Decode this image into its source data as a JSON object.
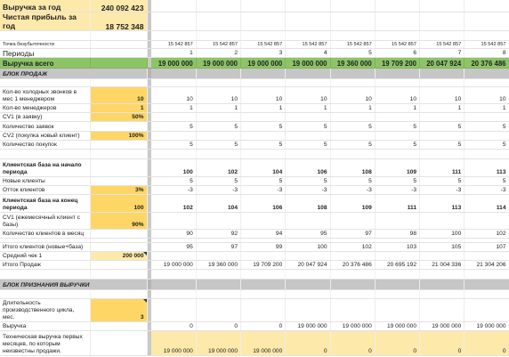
{
  "kpi": {
    "revenue_label": "Выручка за год",
    "revenue_value": "240 092 423",
    "profit_label": "Чистая прибыль за год",
    "profit_value": "18 752 348"
  },
  "breakeven": {
    "label": "Точка безубыточности",
    "values": [
      "15 542 857",
      "15 542 857",
      "15 542 857",
      "15 542 857",
      "15 542 857",
      "15 542 857",
      "15 542 857",
      "15 542 857"
    ]
  },
  "periods": {
    "label": "Периоды",
    "values": [
      "1",
      "2",
      "3",
      "4",
      "5",
      "6",
      "7",
      "8"
    ]
  },
  "revenue_total": {
    "label": "Выручка всего",
    "values": [
      "19 000 000",
      "19 000 000",
      "19 000 000",
      "19 000 000",
      "19 360 000",
      "19 709 200",
      "20 047 924",
      "20 376 486"
    ]
  },
  "sales_block": {
    "title": "БЛОК ПРОДАЖ",
    "rows": [
      {
        "label": "Кол-во холодных звонков в мес 1 менеджером",
        "input": "10",
        "values": [
          "10",
          "10",
          "10",
          "10",
          "10",
          "10",
          "10",
          "10"
        ]
      },
      {
        "label": "Кол-во менеджеров",
        "input": "1",
        "values": [
          "1",
          "1",
          "1",
          "1",
          "1",
          "1",
          "1",
          "1"
        ]
      },
      {
        "label": "CV1 (в заявку)",
        "input": "50%",
        "values": [
          "",
          "",
          "",
          "",
          "",
          "",
          "",
          ""
        ]
      },
      {
        "label": "Количество заявок",
        "input": "",
        "values": [
          "5",
          "5",
          "5",
          "5",
          "5",
          "5",
          "5",
          "5"
        ]
      },
      {
        "label": "CV2 (покупка новый клиент)",
        "input": "100%",
        "values": [
          "",
          "",
          "",
          "",
          "",
          "",
          "",
          ""
        ]
      },
      {
        "label": "Количество покупок",
        "input": "",
        "values": [
          "5",
          "5",
          "5",
          "5",
          "5",
          "5",
          "5",
          "5"
        ]
      },
      {
        "label": "Клиентская база на начало периода",
        "input": "",
        "values": [
          "100",
          "102",
          "104",
          "106",
          "108",
          "109",
          "111",
          "113"
        ]
      },
      {
        "label": "Новые клиенты",
        "input": "",
        "values": [
          "5",
          "5",
          "5",
          "5",
          "5",
          "5",
          "5",
          "5"
        ]
      },
      {
        "label": "Отток клиентов",
        "input": "3%",
        "values": [
          "-3",
          "-3",
          "-3",
          "-3",
          "-3",
          "-3",
          "-3",
          "-3"
        ]
      },
      {
        "label": "Клиентская база на конец периода",
        "input": "100",
        "values": [
          "102",
          "104",
          "106",
          "108",
          "109",
          "111",
          "113",
          "114"
        ]
      },
      {
        "label": "CV1 (ежемесячный клиент с базы)",
        "input": "90%",
        "values": [
          "",
          "",
          "",
          "",
          "",
          "",
          "",
          ""
        ]
      },
      {
        "label": "Количество клиентов в месяц",
        "input": "",
        "values": [
          "90",
          "92",
          "94",
          "95",
          "97",
          "98",
          "100",
          "102"
        ]
      },
      {
        "label": "Итого клиентов (новые+база)",
        "input": "",
        "values": [
          "95",
          "97",
          "99",
          "100",
          "102",
          "103",
          "105",
          "107"
        ]
      },
      {
        "label": "Средний чек 1",
        "input": "200 000",
        "values": [
          "",
          "",
          "",
          "",
          "",
          "",
          "",
          ""
        ]
      },
      {
        "label": "Итого Продаж",
        "input": "",
        "values": [
          "19 000 000",
          "19 360 000",
          "19 709 200",
          "20 047 924",
          "20 376 486",
          "20 695 192",
          "21 004 336",
          "21 304 206"
        ]
      }
    ]
  },
  "recognition_block": {
    "title": "БЛОК ПРИЗНАНИЯ ВЫРУЧКИ",
    "rows": [
      {
        "label": "Длительность производственного цикла, мес.",
        "input": "3",
        "values": [
          "",
          "",
          "",
          "",
          "",
          "",
          "",
          ""
        ]
      },
      {
        "label": "Выручка",
        "input": "",
        "values": [
          "0",
          "0",
          "0",
          "19 000 000",
          "19 000 000",
          "19 000 000",
          "19 000 000",
          "19 000 000"
        ]
      },
      {
        "label": "Техническая выручка первых месяцев, по которым неизвестны продажи.",
        "input": "",
        "values": [
          "19 000 000",
          "19 000 000",
          "19 000 000",
          "0",
          "0",
          "0",
          "0",
          "0"
        ]
      }
    ]
  }
}
